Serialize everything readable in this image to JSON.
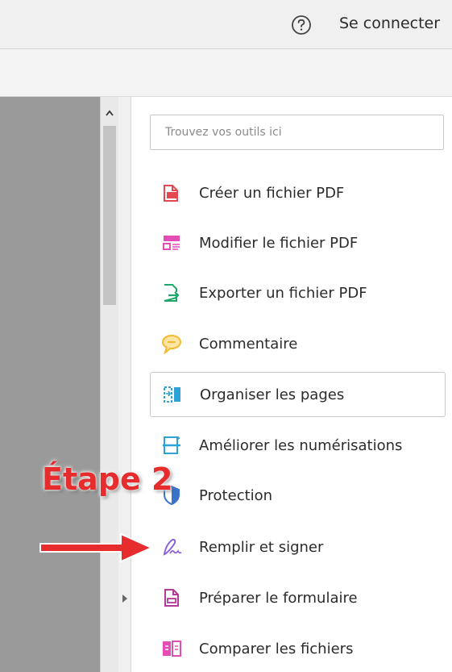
{
  "header": {
    "help_icon": "question-circle-icon",
    "signin_label": "Se connecter"
  },
  "tools_panel": {
    "search": {
      "placeholder": "Trouvez vos outils ici",
      "value": ""
    },
    "items": [
      {
        "label": "Créer un fichier PDF",
        "icon": "create-pdf-icon",
        "color": "#e34850"
      },
      {
        "label": "Modifier le fichier PDF",
        "icon": "edit-pdf-icon",
        "color": "#e44db5"
      },
      {
        "label": "Exporter un fichier PDF",
        "icon": "export-pdf-icon",
        "color": "#1ea86a"
      },
      {
        "label": "Commentaire",
        "icon": "comment-icon",
        "color": "#f5b82e"
      },
      {
        "label": "Organiser les pages",
        "icon": "organize-pages-icon",
        "color": "#2da2d6",
        "selected": true
      },
      {
        "label": "Améliorer les numérisations",
        "icon": "enhance-scans-icon",
        "color": "#2da2d6"
      },
      {
        "label": "Protection",
        "icon": "protect-shield-icon",
        "color": "#3b73c9"
      },
      {
        "label": "Remplir et signer",
        "icon": "fill-sign-pen-icon",
        "color": "#8b65d8"
      },
      {
        "label": "Préparer le formulaire",
        "icon": "prepare-form-icon",
        "color": "#b3399b"
      },
      {
        "label": "Comparer les fichiers",
        "icon": "compare-files-icon",
        "color": "#e44db5"
      }
    ]
  },
  "annotation": {
    "text": "Étape 2",
    "color": "#e62c2c",
    "arrow": "right-arrow-pointing-to-remplir-et-signer"
  }
}
